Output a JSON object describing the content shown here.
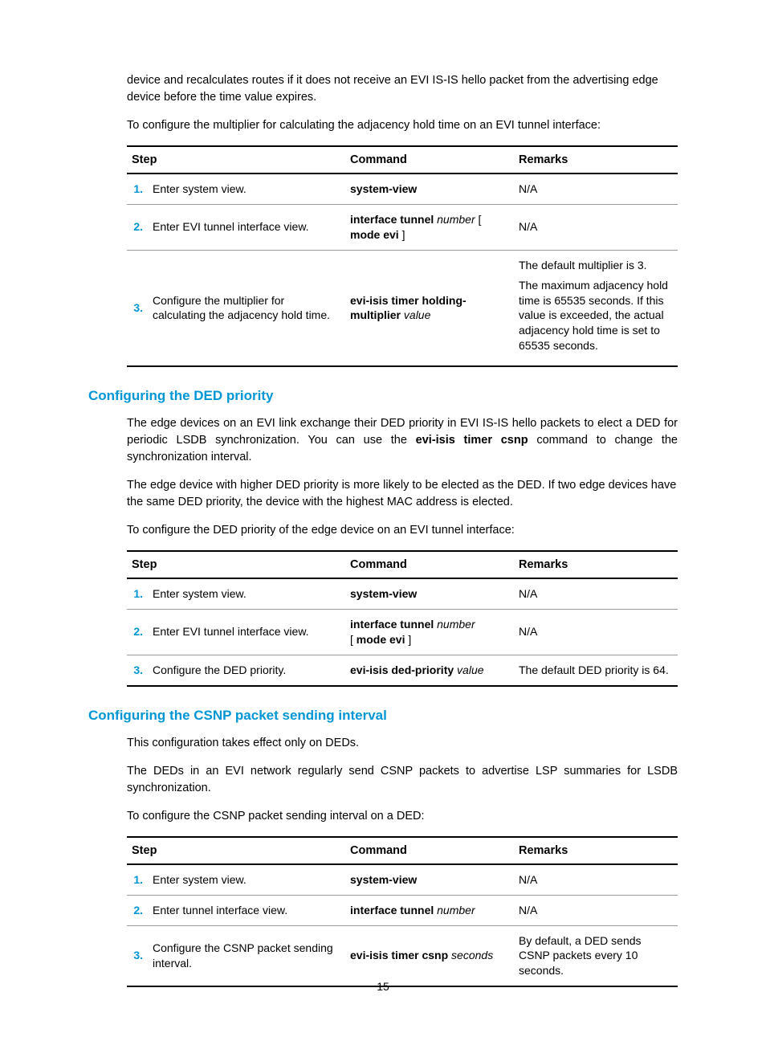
{
  "intro": {
    "p1": "device and recalculates routes if it does not receive an EVI IS-IS hello packet from the advertising edge device before the time value expires.",
    "p2": "To configure the multiplier for calculating the adjacency hold time on an EVI tunnel interface:"
  },
  "table_headers": {
    "step": "Step",
    "command": "Command",
    "remarks": "Remarks"
  },
  "table1": {
    "r1": {
      "n": "1.",
      "step": "Enter system view.",
      "cmd_b": "system-view",
      "rem": "N/A"
    },
    "r2": {
      "n": "2.",
      "step": "Enter EVI tunnel interface view.",
      "cmd_b1": "interface tunnel",
      "cmd_i1": " number ",
      "cmd_t1": "[ ",
      "cmd_b2": "mode evi",
      "cmd_t2": " ]",
      "rem": "N/A"
    },
    "r3": {
      "n": "3.",
      "step": "Configure the multiplier for calculating the adjacency hold time.",
      "cmd_b1": "evi-isis timer holding-multiplier",
      "cmd_i1": " value",
      "rem1": "The default multiplier is 3.",
      "rem2": "The maximum adjacency hold time is 65535 seconds. If this value is exceeded, the actual adjacency hold time is set to 65535 seconds."
    }
  },
  "sec_ded": {
    "heading": "Configuring the DED priority",
    "p1a": "The edge devices on an EVI link exchange their DED priority in EVI IS-IS hello packets to elect a DED for periodic LSDB synchronization. You can use the ",
    "p1b": "evi-isis timer csnp",
    "p1c": " command to change the synchronization interval.",
    "p2": "The edge device with higher DED priority is more likely to be elected as the DED. If two edge devices have the same DED priority, the device with the highest MAC address is elected.",
    "p3": "To configure the DED priority of the edge device on an EVI tunnel interface:"
  },
  "table2": {
    "r1": {
      "n": "1.",
      "step": "Enter system view.",
      "cmd_b": "system-view",
      "rem": "N/A"
    },
    "r2": {
      "n": "2.",
      "step": "Enter EVI tunnel interface view.",
      "cmd_b1": "interface tunnel",
      "cmd_i1": " number",
      "cmd_t1": " [ ",
      "cmd_b2": "mode evi",
      "cmd_t2": " ]",
      "rem": "N/A"
    },
    "r3": {
      "n": "3.",
      "step": "Configure the DED priority.",
      "cmd_b1": "evi-isis ded-priority",
      "cmd_i1": " value",
      "rem": "The default DED priority is 64."
    }
  },
  "sec_csnp": {
    "heading": "Configuring the CSNP packet sending interval",
    "p1": "This configuration takes effect only on DEDs.",
    "p2": "The DEDs in an EVI network regularly send CSNP packets to advertise LSP summaries for LSDB synchronization.",
    "p3": "To configure the CSNP packet sending interval on a DED:"
  },
  "table3": {
    "r1": {
      "n": "1.",
      "step": "Enter system view.",
      "cmd_b": "system-view",
      "rem": "N/A"
    },
    "r2": {
      "n": "2.",
      "step": "Enter tunnel interface view.",
      "cmd_b1": "interface tunnel",
      "cmd_i1": " number",
      "rem": "N/A"
    },
    "r3": {
      "n": "3.",
      "step": "Configure the CSNP packet sending interval.",
      "cmd_b1": "evi-isis timer csnp",
      "cmd_i1": " seconds",
      "rem": "By default, a DED sends CSNP packets every 10 seconds."
    }
  },
  "page_number": "15"
}
